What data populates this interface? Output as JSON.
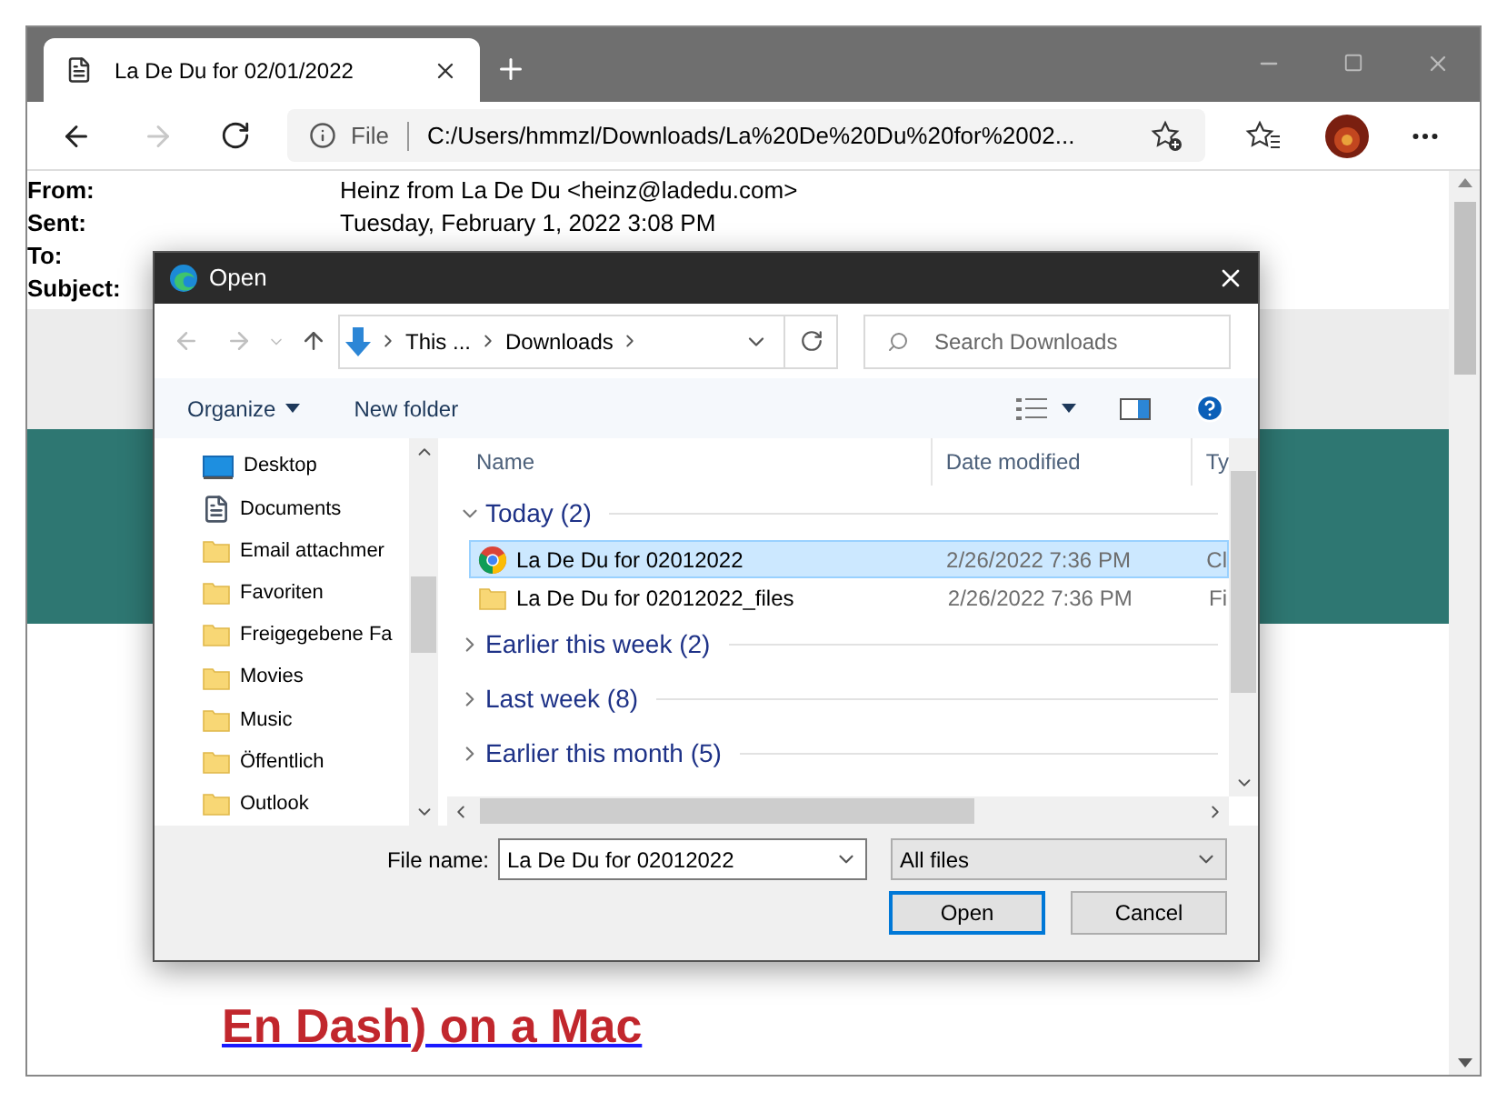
{
  "browser": {
    "tab": {
      "title": "La De Du for 02/01/2022"
    },
    "address": {
      "scheme": "File",
      "url": "C:/Users/hmmzl/Downloads/La%20De%20Du%20for%2002..."
    }
  },
  "email_header": [
    {
      "label": "From:",
      "value": "Heinz from La De Du <heinz@ladedu.com>"
    },
    {
      "label": "Sent:",
      "value": "Tuesday, February 1, 2022 3:08 PM"
    },
    {
      "label": "To:"
    },
    {
      "label": "Subject:"
    }
  ],
  "article": {
    "headline_lines": [
      "En Dash) on a Mac"
    ]
  },
  "dialog": {
    "title": "Open",
    "breadcrumb": [
      "This ...",
      "Downloads"
    ],
    "search": {
      "placeholder": "Search Downloads"
    },
    "toolbar": [
      "Organize",
      "New folder"
    ],
    "nav_items": [
      {
        "label": "Desktop",
        "kind": "desktop"
      },
      {
        "label": "Documents",
        "kind": "documents"
      },
      {
        "label": "Email attachmer",
        "kind": "folder"
      },
      {
        "label": "Favoriten",
        "kind": "folder"
      },
      {
        "label": "Freigegebene Fa",
        "kind": "folder"
      },
      {
        "label": "Movies",
        "kind": "folder"
      },
      {
        "label": "Music",
        "kind": "folder"
      },
      {
        "label": "Öffentlich",
        "kind": "folder"
      },
      {
        "label": "Outlook",
        "kind": "folder"
      }
    ],
    "columns": [
      "Name",
      "Date modified",
      "Ty"
    ],
    "groups": [
      {
        "label": "Today (2)",
        "expanded": true,
        "files": [
          {
            "name": "La De Du for 02012022",
            "date": "2/26/2022 7:36 PM",
            "type": "Cl",
            "kind": "browser-file",
            "selected": true
          },
          {
            "name": "La De Du for 02012022_files",
            "date": "2/26/2022 7:36 PM",
            "type": "Fi",
            "kind": "folder",
            "selected": false
          }
        ]
      },
      {
        "label": "Earlier this week (2)",
        "expanded": false
      },
      {
        "label": "Last week (8)",
        "expanded": false
      },
      {
        "label": "Earlier this month (5)",
        "expanded": false
      }
    ],
    "file_name": {
      "label": "File name:",
      "value": "La De Du for 02012022"
    },
    "filter": "All files",
    "buttons": [
      {
        "label": "Open",
        "default": true
      },
      {
        "label": "Cancel",
        "default": false
      }
    ]
  }
}
